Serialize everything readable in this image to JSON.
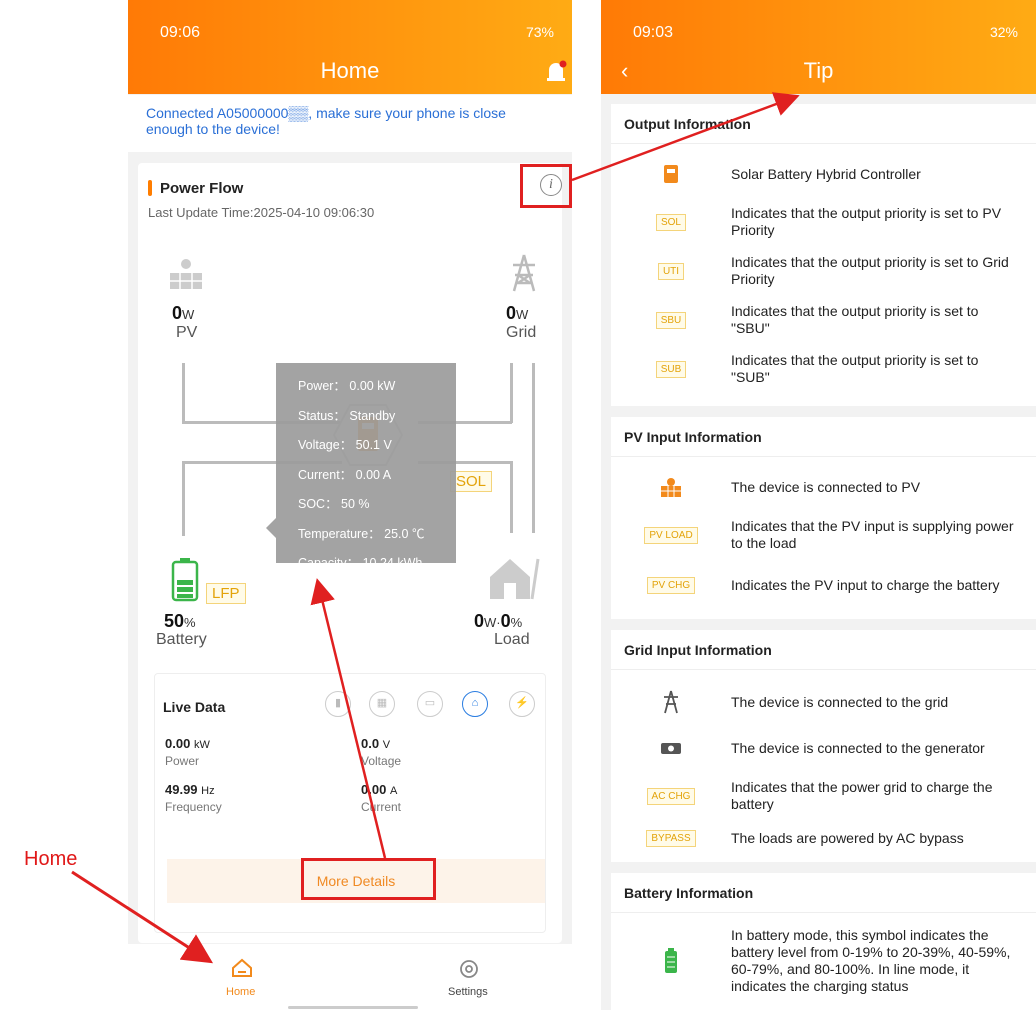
{
  "colors": {
    "accent": "#ff8a0a",
    "annotation": "#e02020",
    "link": "#2a6fd6"
  },
  "left": {
    "status_time": "09:06",
    "status_icons": "73%",
    "title": "Home",
    "notice": "Connected A05000000▒▒, make sure your phone is close enough to the device!",
    "power_flow": {
      "title": "Power Flow",
      "last_update": "Last Update Time:2025-04-10 09:06:30",
      "info_icon": "i",
      "pv": {
        "value": "0",
        "unit": "W",
        "label": "PV"
      },
      "grid": {
        "value": "0",
        "unit": "W",
        "label": "Grid"
      },
      "battery": {
        "value": "50",
        "unit": "%",
        "label": "Battery",
        "tag": "LFP"
      },
      "load": {
        "value": "0",
        "unit": "W",
        "sep": "·",
        "value2": "0",
        "unit2": "%",
        "label": "Load"
      },
      "sol_tag": "SOL",
      "tooltip": [
        "Power： 0.00 kW",
        "Status： Standby",
        "Voltage： 50.1 V",
        "Current： 0.00 A",
        "SOC： 50 %",
        "Temperature： 25.0 ℃",
        "Capacity： 10.24 kWh"
      ]
    },
    "live_data": {
      "title": "Live Data",
      "power": {
        "value": "0.00",
        "unit": "kW",
        "label": "Power"
      },
      "voltage": {
        "value": "0.0",
        "unit": "V",
        "label": "Voltage"
      },
      "frequency": {
        "value": "49.99",
        "unit": "Hz",
        "label": "Frequency"
      },
      "current": {
        "value": "0.00",
        "unit": "A",
        "label": "Current"
      },
      "more": "More Details"
    },
    "tabs": {
      "home": "Home",
      "settings": "Settings"
    }
  },
  "right": {
    "status_time": "09:03",
    "status_icons": "32%",
    "title": "Tip",
    "sections": {
      "output": {
        "title": "Output Information",
        "items": [
          {
            "tag": "",
            "text": "Solar Battery Hybrid Controller"
          },
          {
            "tag": "SOL",
            "text": "Indicates that the output priority is set to PV Priority"
          },
          {
            "tag": "UTI",
            "text": "Indicates that the output priority is set to Grid Priority"
          },
          {
            "tag": "SBU",
            "text": "Indicates that the output priority is set to \"SBU\""
          },
          {
            "tag": "SUB",
            "text": "Indicates that the output priority is set to \"SUB\""
          }
        ]
      },
      "pv": {
        "title": "PV Input Information",
        "items": [
          {
            "tag": "",
            "text": "The device is connected to PV"
          },
          {
            "tag": "PV LOAD",
            "text": "Indicates that the PV input is supplying power to the load"
          },
          {
            "tag": "PV CHG",
            "text": "Indicates the PV input to charge the battery"
          }
        ]
      },
      "grid": {
        "title": "Grid Input Information",
        "items": [
          {
            "tag": "",
            "text": "The device is connected to the grid"
          },
          {
            "tag": "",
            "text": "The device is connected to the generator"
          },
          {
            "tag": "AC CHG",
            "text": "Indicates that the power grid to charge the battery"
          },
          {
            "tag": "BYPASS",
            "text": "The loads are powered by AC bypass"
          }
        ]
      },
      "battery": {
        "title": "Battery Information",
        "items": [
          {
            "tag": "",
            "text": "In battery mode, this symbol indicates the battery level from 0-19% to 20-39%, 40-59%, 60-79%, and 80-100%. In line mode, it indicates the charging status"
          }
        ]
      }
    }
  },
  "annotation": {
    "label": "Home"
  }
}
